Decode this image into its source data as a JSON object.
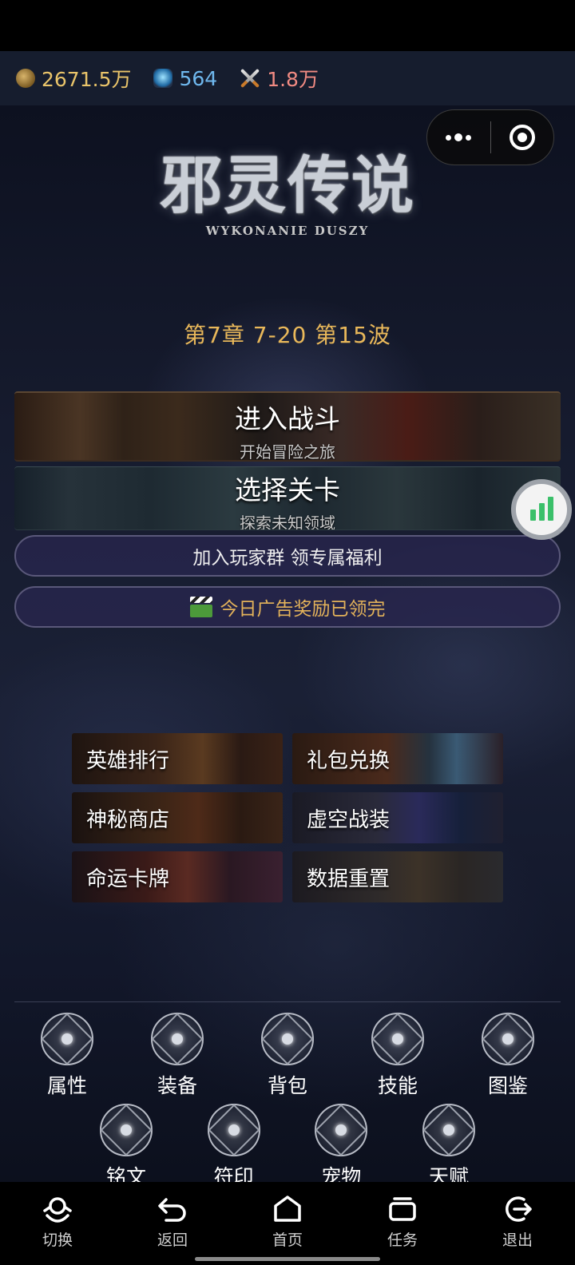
{
  "resources": {
    "gold": "2671.5万",
    "diamond": "564",
    "power": "1.8万",
    "colors": {
      "gold": "#e9c46a",
      "diamond": "#6fb8ee",
      "power": "#f08a82"
    }
  },
  "logo": {
    "title": "邪灵传说",
    "subtitle": "WYKONANIE DUSZY"
  },
  "progress_text": "第7章  7-20  第15波",
  "banners": {
    "battle": {
      "title": "进入战斗",
      "subtitle": "开始冒险之旅"
    },
    "select": {
      "title": "选择关卡",
      "subtitle": "探索未知领域"
    }
  },
  "buttons": {
    "join_group": "加入玩家群  领专属福利",
    "ad_reward": "今日广告奖励已领完"
  },
  "menu": [
    "英雄排行",
    "礼包兑换",
    "神秘商店",
    "虚空战装",
    "命运卡牌",
    "数据重置"
  ],
  "bottom_nav": {
    "row1": [
      "属性",
      "装备",
      "背包",
      "技能",
      "图鉴"
    ],
    "row2": [
      "铭文",
      "符印",
      "宠物",
      "天赋"
    ]
  },
  "system_nav": [
    "切换",
    "返回",
    "首页",
    "任务",
    "退出"
  ],
  "icons": {
    "gold": "coin-icon",
    "diamond": "gem-icon",
    "power": "crossed-swords-icon",
    "capsule_more": "more-dots-icon",
    "capsule_close": "target-icon",
    "ad": "clapper-icon",
    "float": "signal-bars-icon"
  }
}
